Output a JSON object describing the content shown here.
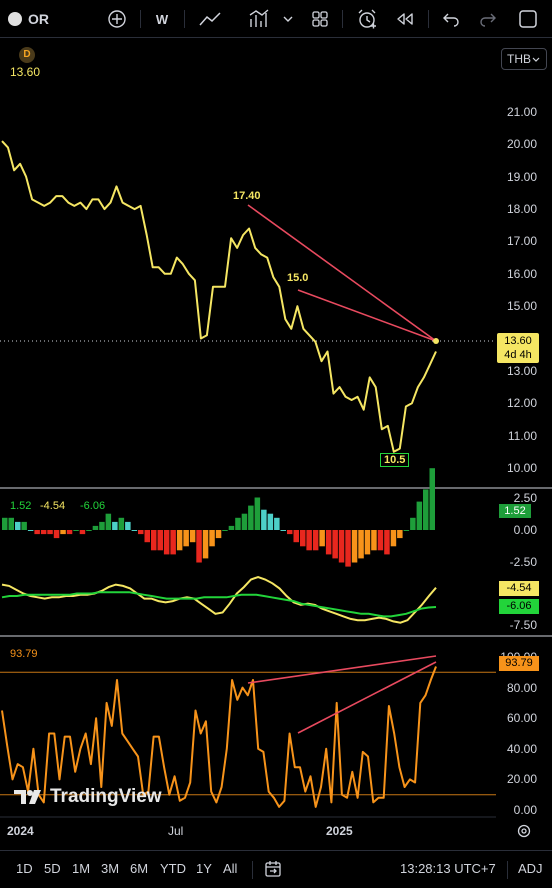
{
  "toolbar": {
    "symbol": "OR",
    "interval": "W"
  },
  "currency": "THB",
  "legend": {
    "badge": "D",
    "price": "13.60"
  },
  "colors": {
    "price_line": "#f5e663",
    "divergence": "#e84a5f",
    "osc_line": "#f7931a",
    "macd_signal": "#22d43a",
    "macd_line": "#f5e663"
  },
  "price_axis": [
    "21.00",
    "20.00",
    "19.00",
    "18.00",
    "17.00",
    "16.00",
    "15.00",
    "14.00",
    "13.00",
    "12.00",
    "11.00",
    "10.00"
  ],
  "price_tag": {
    "value": "13.60",
    "countdown": "4d 4h"
  },
  "annotations": {
    "high1": "17.40",
    "high2": "15.0",
    "low": "10.5"
  },
  "macd": {
    "legend": [
      "1.52",
      "-4.54",
      "-6.06"
    ],
    "axis": [
      "2.50",
      "0.00",
      "-2.50",
      "-7.50"
    ],
    "tags": [
      "1.52",
      "-4.54",
      "-6.06"
    ]
  },
  "osc": {
    "legend": "93.79",
    "axis": [
      "100.00",
      "80.00",
      "60.00",
      "40.00",
      "20.00",
      "0.00"
    ],
    "tag": "93.79",
    "watermark": "TradingView"
  },
  "time_axis": [
    "2024",
    "Jul",
    "2025"
  ],
  "bottom": {
    "ranges": [
      "1D",
      "5D",
      "1M",
      "3M",
      "6M",
      "YTD",
      "1Y",
      "All"
    ],
    "clock": "13:28:13 UTC+7",
    "adj": "ADJ"
  },
  "chart_data": [
    {
      "type": "line",
      "name": "price",
      "x": [
        0,
        1,
        2,
        3,
        4,
        5,
        6,
        7,
        8,
        9,
        10,
        11,
        12,
        13,
        14,
        15,
        16,
        17,
        18,
        19,
        20,
        21,
        22,
        23,
        24,
        25,
        26,
        27,
        28,
        29,
        30,
        31,
        32,
        33,
        34,
        35,
        36,
        37,
        38,
        39,
        40,
        41,
        42,
        43,
        44,
        45,
        46,
        47,
        48,
        49,
        50,
        51,
        52,
        53,
        54,
        55,
        56,
        57,
        58,
        59,
        60,
        61,
        62,
        63,
        64,
        65,
        66,
        67,
        68,
        69,
        70,
        71,
        72
      ],
      "y": [
        20.1,
        19.9,
        19.2,
        19.4,
        19.0,
        18.3,
        18.2,
        18.1,
        18.2,
        18.4,
        18.4,
        18.2,
        18.1,
        18.2,
        18.0,
        18.3,
        18.3,
        18.0,
        18.2,
        18.7,
        18.2,
        18.1,
        18.0,
        18.1,
        17.2,
        16.2,
        16.2,
        16.0,
        16.0,
        16.5,
        16.3,
        16.0,
        15.8,
        14.0,
        14.1,
        15.6,
        15.6,
        15.6,
        17.1,
        16.8,
        17.2,
        17.4,
        16.8,
        16.6,
        16.5,
        15.9,
        15.6,
        14.6,
        14.3,
        15.0,
        14.3,
        14.1,
        13.9,
        13.3,
        13.6,
        12.3,
        12.5,
        12.2,
        12.1,
        12.2,
        11.8,
        12.8,
        12.5,
        11.2,
        11.3,
        10.5,
        10.6,
        11.9,
        12.0,
        12.5,
        12.8,
        13.2,
        13.6
      ],
      "ylim": [
        9.6,
        22.0
      ]
    },
    {
      "type": "bar",
      "name": "macd_hist",
      "values": [
        0.3,
        0.3,
        0.2,
        0.2,
        0.0,
        -0.1,
        -0.1,
        -0.1,
        -0.2,
        -0.1,
        -0.1,
        0.0,
        -0.1,
        0.0,
        0.1,
        0.2,
        0.4,
        0.2,
        0.3,
        0.2,
        0.0,
        -0.1,
        -0.3,
        -0.5,
        -0.5,
        -0.6,
        -0.6,
        -0.5,
        -0.4,
        -0.3,
        -0.8,
        -0.7,
        -0.4,
        -0.2,
        0.0,
        0.1,
        0.3,
        0.4,
        0.6,
        0.8,
        0.5,
        0.4,
        0.3,
        0.0,
        -0.1,
        -0.3,
        -0.4,
        -0.5,
        -0.5,
        -0.4,
        -0.6,
        -0.7,
        -0.8,
        -0.9,
        -0.8,
        -0.7,
        -0.6,
        -0.5,
        -0.5,
        -0.6,
        -0.4,
        -0.2,
        0.0,
        0.3,
        0.7,
        1.0,
        1.52
      ],
      "ylim": [
        -9,
        3
      ]
    },
    {
      "type": "line",
      "name": "macd_lines",
      "series": [
        {
          "values": [
            -4.3,
            -4.4,
            -4.7,
            -5.0,
            -5.2,
            -5.3,
            -5.4,
            -5.3,
            -5.3,
            -5.2,
            -5.2,
            -5.1,
            -5.1,
            -5.0,
            -4.8,
            -4.5,
            -4.3,
            -4.4,
            -4.6,
            -5.0,
            -5.4,
            -5.4,
            -5.6,
            -5.7,
            -5.6,
            -5.4,
            -5.3,
            -5.4,
            -5.8,
            -6.2,
            -6.6,
            -6.5,
            -5.8,
            -5.0,
            -4.5,
            -3.9,
            -3.7,
            -3.9,
            -4.2,
            -4.6,
            -5.2,
            -5.7,
            -5.9,
            -5.8,
            -5.9,
            -6.2,
            -6.4,
            -6.6,
            -6.8,
            -7.0,
            -7.1,
            -7.1,
            -7.0,
            -6.9,
            -7.0,
            -7.2,
            -7.3,
            -7.1,
            -6.5,
            -5.9,
            -5.2,
            -4.54
          ]
        },
        {
          "values": [
            -5.3,
            -5.2,
            -5.2,
            -5.1,
            -5.1,
            -5.1,
            -5.1,
            -5.1,
            -5.1,
            -5.1,
            -5.0,
            -5.0,
            -5.0,
            -4.9,
            -4.9,
            -4.9,
            -4.9,
            -4.9,
            -5.0,
            -5.1,
            -5.2,
            -5.3,
            -5.4,
            -5.4,
            -5.4,
            -5.4,
            -5.4,
            -5.3,
            -5.3,
            -5.3,
            -5.3,
            -5.2,
            -5.1,
            -5.1,
            -5.1,
            -5.2,
            -5.3,
            -5.4,
            -5.5,
            -5.6,
            -5.8,
            -5.9,
            -6.0,
            -6.1,
            -6.2,
            -6.3,
            -6.4,
            -6.5,
            -6.6,
            -6.6,
            -6.7,
            -6.8,
            -6.8,
            -6.7,
            -6.6,
            -6.4,
            -6.2,
            -6.1,
            -6.06
          ]
        }
      ]
    },
    {
      "type": "line",
      "name": "oscillator",
      "values": [
        65,
        42,
        20,
        30,
        28,
        12,
        40,
        10,
        5,
        50,
        50,
        20,
        48,
        48,
        25,
        40,
        50,
        30,
        60,
        15,
        70,
        55,
        85,
        50,
        45,
        40,
        35,
        10,
        12,
        48,
        48,
        28,
        10,
        22,
        6,
        8,
        18,
        65,
        50,
        58,
        12,
        5,
        15,
        40,
        85,
        72,
        80,
        75,
        85,
        40,
        38,
        12,
        8,
        2,
        6,
        50,
        28,
        28,
        12,
        22,
        2,
        15,
        40,
        5,
        70,
        10,
        8,
        25,
        8,
        38,
        35,
        5,
        8,
        8,
        68,
        50,
        28,
        15,
        20,
        18,
        70,
        75,
        85,
        93.79
      ],
      "ylim": [
        -5,
        108
      ],
      "hlines": [
        90,
        10
      ]
    }
  ]
}
